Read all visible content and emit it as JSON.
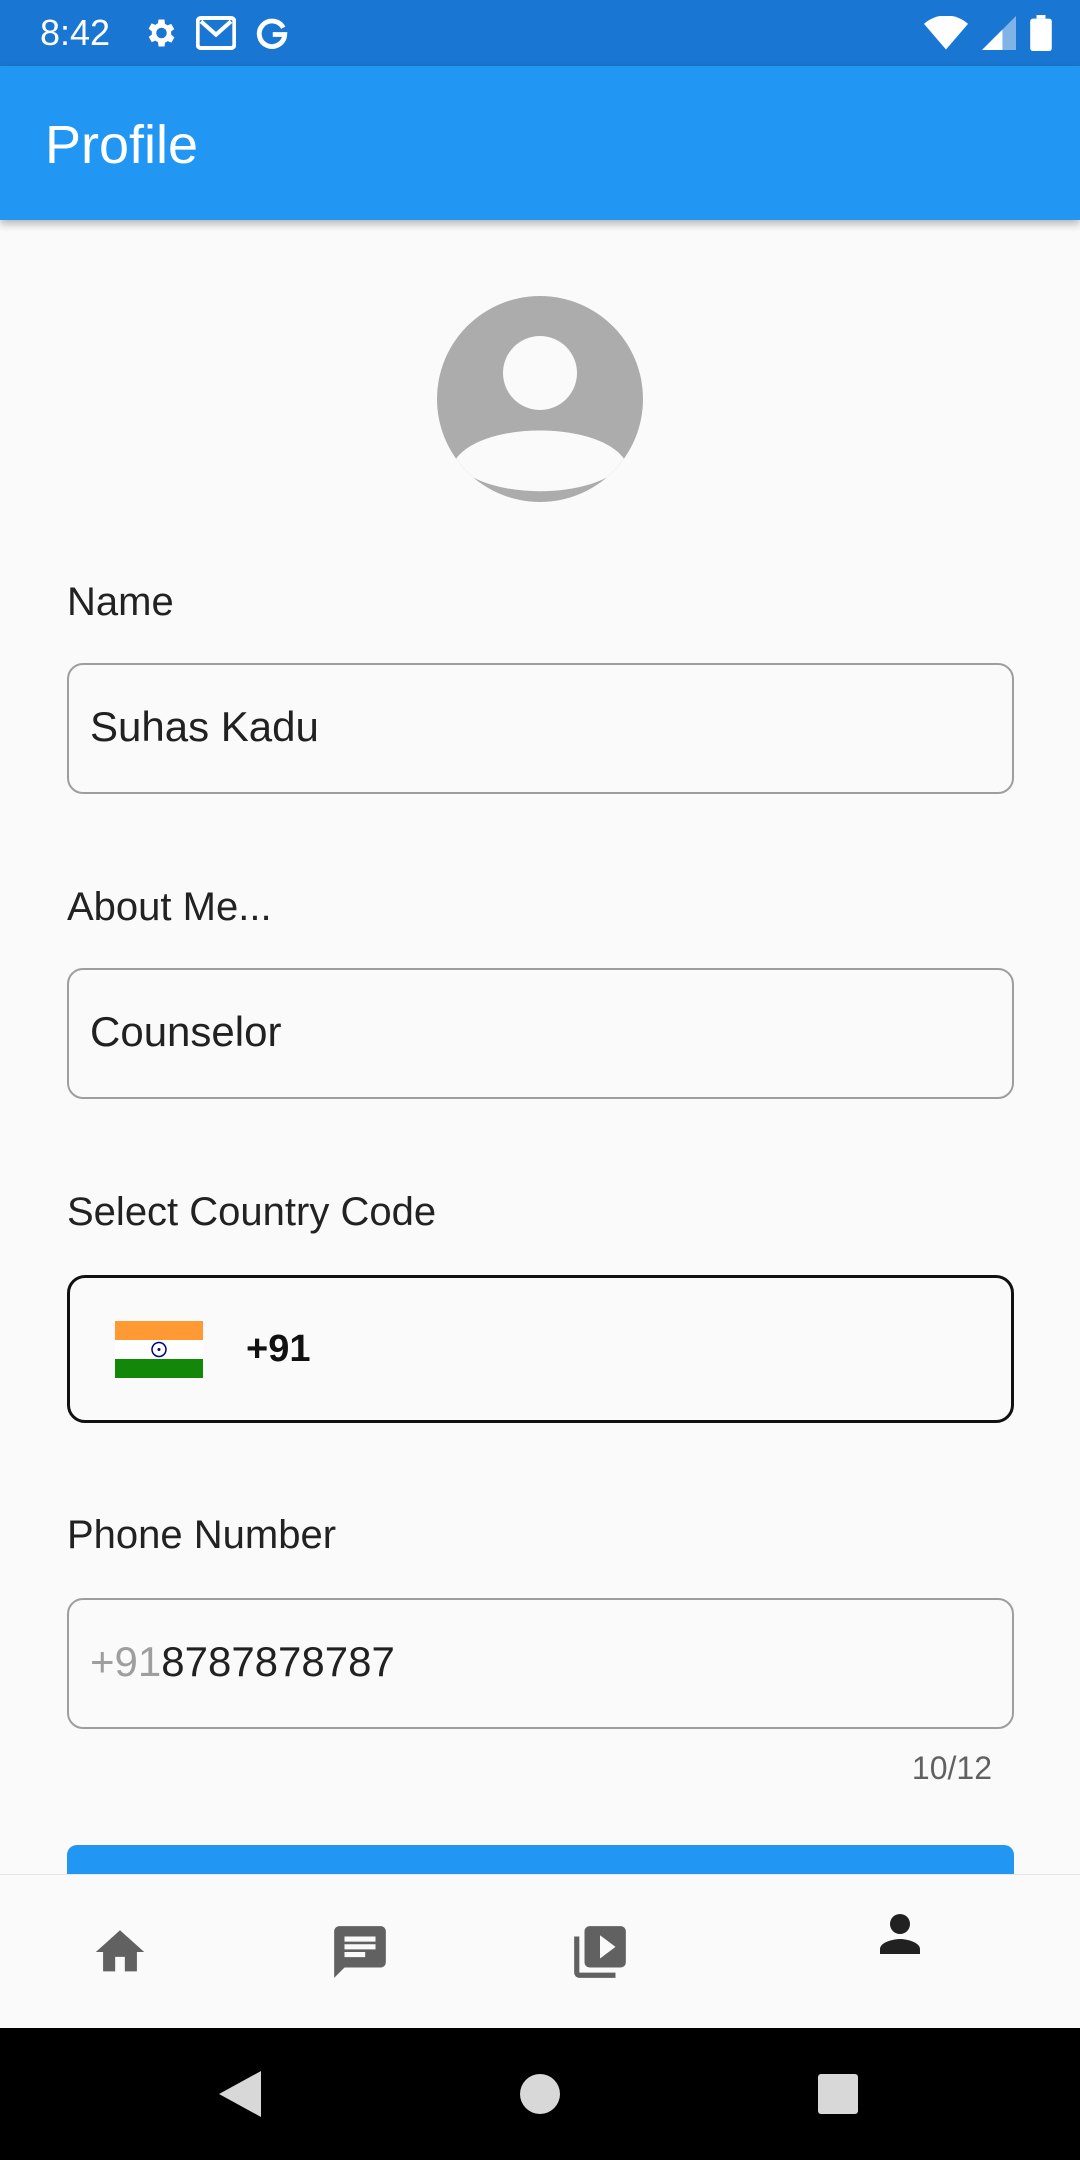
{
  "status_bar": {
    "time": "8:42",
    "left_icons": [
      "gear-icon",
      "gmail-icon",
      "google-icon"
    ],
    "right_icons": [
      "wifi-icon",
      "cell-signal-icon",
      "battery-icon"
    ]
  },
  "app_bar": {
    "title": "Profile"
  },
  "avatar": {
    "icon": "account-circle-icon"
  },
  "form": {
    "name": {
      "label": "Name",
      "value": "Suhas Kadu"
    },
    "about": {
      "label": "About Me...",
      "value": "Counselor"
    },
    "country": {
      "label": "Select Country Code",
      "flag": "india-flag-icon",
      "code": "+91"
    },
    "phone": {
      "label": "Phone Number",
      "prefix": "+91",
      "value": "8787878787",
      "counter": "10/12"
    }
  },
  "bottom_nav": {
    "items": [
      {
        "icon": "home-icon",
        "active": false
      },
      {
        "icon": "chat-icon",
        "active": false
      },
      {
        "icon": "video-library-icon",
        "active": false
      },
      {
        "icon": "person-icon",
        "active": true
      }
    ]
  },
  "system_nav": {
    "buttons": [
      "back-icon",
      "home-circle-icon",
      "recents-icon"
    ]
  },
  "colors": {
    "status_bar": "#1976d2",
    "app_bar": "#2196f3",
    "background": "#fafafa",
    "field_border": "#9e9e9e",
    "inactive_icon": "#616161",
    "active_icon": "#212121"
  }
}
